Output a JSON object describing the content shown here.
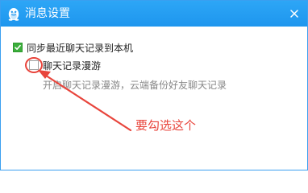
{
  "window": {
    "title": "消息设置",
    "app_icon": "qq-penguin-icon",
    "close_icon": "close-icon"
  },
  "settings": {
    "sync_recent": {
      "label": "同步最近聊天记录到本机",
      "checked": true
    },
    "chat_roaming": {
      "label": "聊天记录漫游",
      "checked": false,
      "description": "开启聊天记录漫游，云端备份好友聊天记录"
    }
  },
  "annotation": {
    "text": "要勾选这个",
    "color": "#e8453c"
  },
  "colors": {
    "titlebar": "#1e96ee",
    "checkbox_checked": "#3cae3c",
    "annotation": "#e8453c"
  }
}
